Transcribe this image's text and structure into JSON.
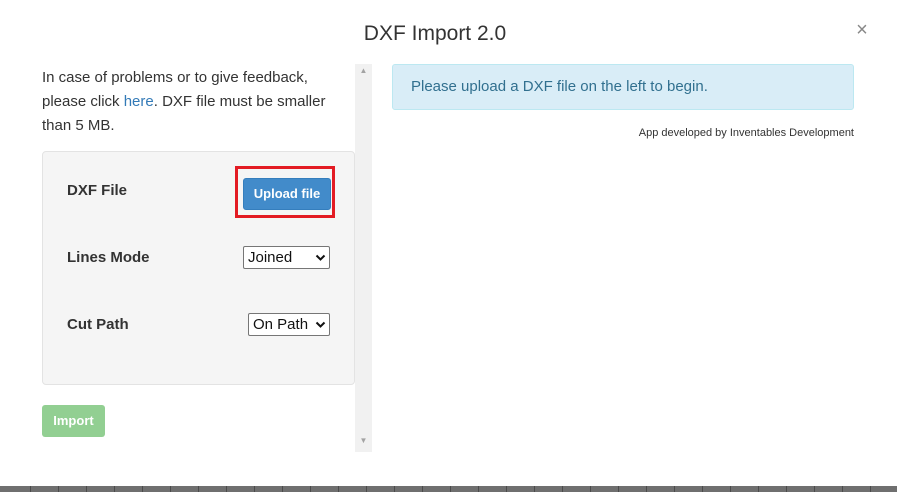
{
  "dialog": {
    "title": "DXF Import 2.0",
    "close_glyph": "×"
  },
  "intro": {
    "text_before_link": "In case of problems or to give feedback, please click ",
    "link_text": "here",
    "text_after_link": ". DXF file must be smaller than 5 MB."
  },
  "form": {
    "dxf_file_label": "DXF File",
    "upload_button_label": "Upload file",
    "lines_mode_label": "Lines Mode",
    "lines_mode_selected": "Joined",
    "cut_path_label": "Cut Path",
    "cut_path_selected": "On Path",
    "import_button_label": "Import"
  },
  "info": {
    "message": "Please upload a DXF file on the left to begin.",
    "credit": "App developed by Inventables Development"
  },
  "scrollbar": {
    "up_glyph": "▲",
    "down_glyph": "▼"
  },
  "icons": {
    "close": "close-icon",
    "select_chevron": "chevron-down-icon",
    "scroll_up": "scroll-up-arrow-icon",
    "scroll_down": "scroll-down-arrow-icon"
  },
  "colors": {
    "upload_button": "#428bca",
    "import_button": "#80c780",
    "highlight": "#e31b23",
    "info_background": "#d9edf7",
    "info_text": "#31708f",
    "link": "#337ab7"
  }
}
